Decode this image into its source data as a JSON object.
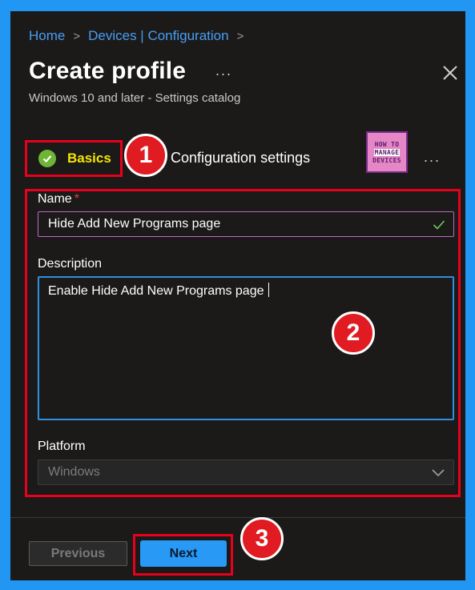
{
  "breadcrumb": {
    "items": [
      "Home",
      "Devices | Configuration"
    ],
    "separator": ">"
  },
  "header": {
    "title": "Create profile",
    "more_label": "...",
    "subtitle": "Windows 10 and later - Settings catalog"
  },
  "wizard": {
    "steps": [
      {
        "label": "Basics",
        "state": "complete"
      },
      {
        "label": "Configuration settings"
      }
    ],
    "more_label": "..."
  },
  "logo": {
    "line1": "HOW TO",
    "line2": "MANAGE",
    "line3": "DEVICES"
  },
  "form": {
    "name_label": "Name",
    "required_mark": "*",
    "name_value": "Hide Add New Programs page",
    "description_label": "Description",
    "description_value": "Enable Hide Add New Programs page",
    "platform_label": "Platform",
    "platform_value": "Windows"
  },
  "footer": {
    "previous_label": "Previous",
    "next_label": "Next"
  },
  "callouts": [
    "1",
    "2",
    "3"
  ],
  "colors": {
    "frame": "#2196f3",
    "panel": "#1b1a19",
    "link": "#479ef5",
    "highlight": "#e8001c",
    "basics_text": "#f3e600",
    "primary_button": "#2899f5"
  }
}
